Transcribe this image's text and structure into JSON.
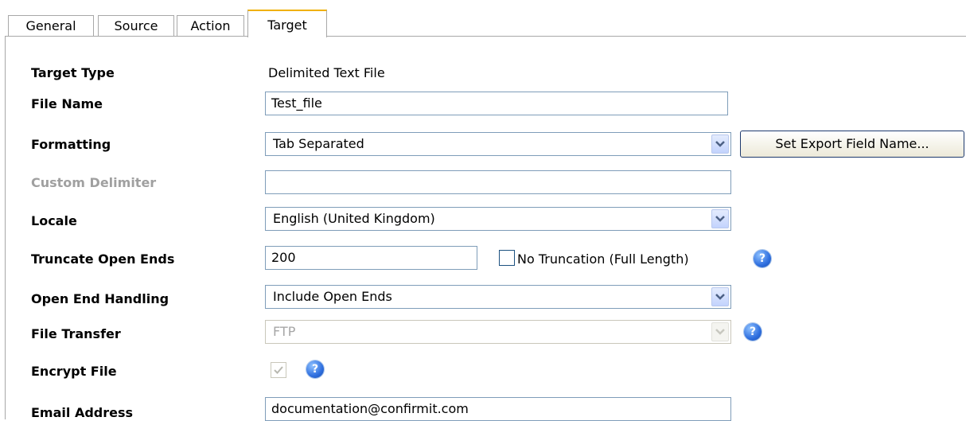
{
  "tabs": [
    {
      "label": "General"
    },
    {
      "label": "Source"
    },
    {
      "label": "Action"
    },
    {
      "label": "Target"
    }
  ],
  "form": {
    "target_type": {
      "label": "Target Type",
      "value": "Delimited Text File"
    },
    "file_name": {
      "label": "File Name",
      "value": "Test_file"
    },
    "formatting": {
      "label": "Formatting",
      "value": "Tab Separated",
      "button": "Set Export Field Name..."
    },
    "custom_delimiter": {
      "label": "Custom Delimiter",
      "value": ""
    },
    "locale": {
      "label": "Locale",
      "value": "English (United Kingdom)"
    },
    "truncate": {
      "label": "Truncate Open Ends",
      "value": "200",
      "checkbox_label": "No Truncation (Full Length)",
      "checked": false
    },
    "open_end_handling": {
      "label": "Open End Handling",
      "value": "Include Open Ends"
    },
    "file_transfer": {
      "label": "File Transfer",
      "value": "FTP"
    },
    "encrypt_file": {
      "label": "Encrypt File",
      "checked": true
    },
    "email_address": {
      "label": "Email Address",
      "value": "documentation@confirmit.com"
    }
  },
  "icons": {
    "help": "?",
    "checkmark": "✓"
  },
  "colors": {
    "active_tab_accent": "#f0b000",
    "input_border": "#7f9db9",
    "disabled_text": "#a0a0a0",
    "help_icon": "#2f6fdf"
  }
}
